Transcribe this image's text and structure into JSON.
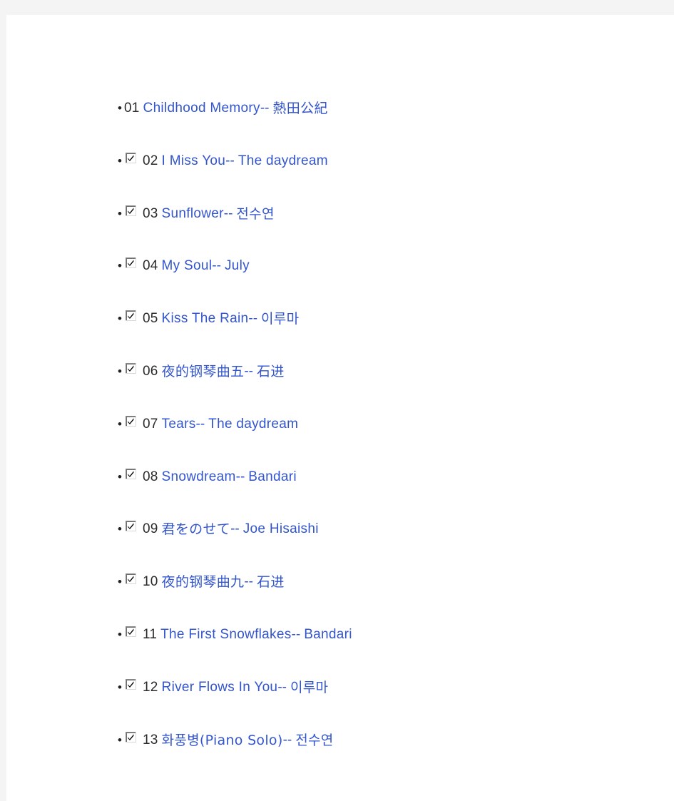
{
  "page": {
    "background_color": "#f4f4f4",
    "content_background_color": "#ffffff",
    "link_color": "#3355cc",
    "number_color": "#2b2b2b"
  },
  "track_list": {
    "name": "piano-track-list",
    "separator": "--",
    "items": [
      {
        "number": "01",
        "title": "Childhood Memory",
        "separator": "--",
        "artist": "熱田公紀",
        "checkbox": false,
        "checkbox_state": "none"
      },
      {
        "number": "02",
        "title": "I Miss You",
        "separator": "--",
        "artist": "The daydream",
        "checkbox": true,
        "checkbox_state": "checked"
      },
      {
        "number": "03",
        "title": "Sunflower",
        "separator": "--",
        "artist": "전수연",
        "checkbox": true,
        "checkbox_state": "checked"
      },
      {
        "number": "04",
        "title": "My Soul",
        "separator": "--",
        "artist": "July",
        "checkbox": true,
        "checkbox_state": "checked"
      },
      {
        "number": "05",
        "title": "Kiss The Rain",
        "separator": "--",
        "artist": "이루마",
        "checkbox": true,
        "checkbox_state": "checked"
      },
      {
        "number": "06",
        "title": "夜的钢琴曲五",
        "separator": "--",
        "artist": "石进",
        "checkbox": true,
        "checkbox_state": "checked"
      },
      {
        "number": "07",
        "title": "Tears",
        "separator": "--",
        "artist": "The daydream",
        "checkbox": true,
        "checkbox_state": "checked"
      },
      {
        "number": "08",
        "title": "Snowdream",
        "separator": "--",
        "artist": "Bandari",
        "checkbox": true,
        "checkbox_state": "checked"
      },
      {
        "number": "09",
        "title": "君をのせて",
        "separator": "--",
        "artist": "Joe Hisaishi",
        "checkbox": true,
        "checkbox_state": "checked"
      },
      {
        "number": "10",
        "title": "夜的钢琴曲九",
        "separator": "--",
        "artist": "石进",
        "checkbox": true,
        "checkbox_state": "checked"
      },
      {
        "number": "11",
        "title": "The First Snowflakes",
        "separator": "--",
        "artist": "Bandari",
        "checkbox": true,
        "checkbox_state": "checked"
      },
      {
        "number": "12",
        "title": "River Flows In You",
        "separator": "--",
        "artist": "이루마",
        "checkbox": true,
        "checkbox_state": "checked"
      },
      {
        "number": "13",
        "title": "화풍병(Piano Solo)",
        "separator": "--",
        "artist": "전수연",
        "checkbox": true,
        "checkbox_state": "checked"
      }
    ]
  }
}
